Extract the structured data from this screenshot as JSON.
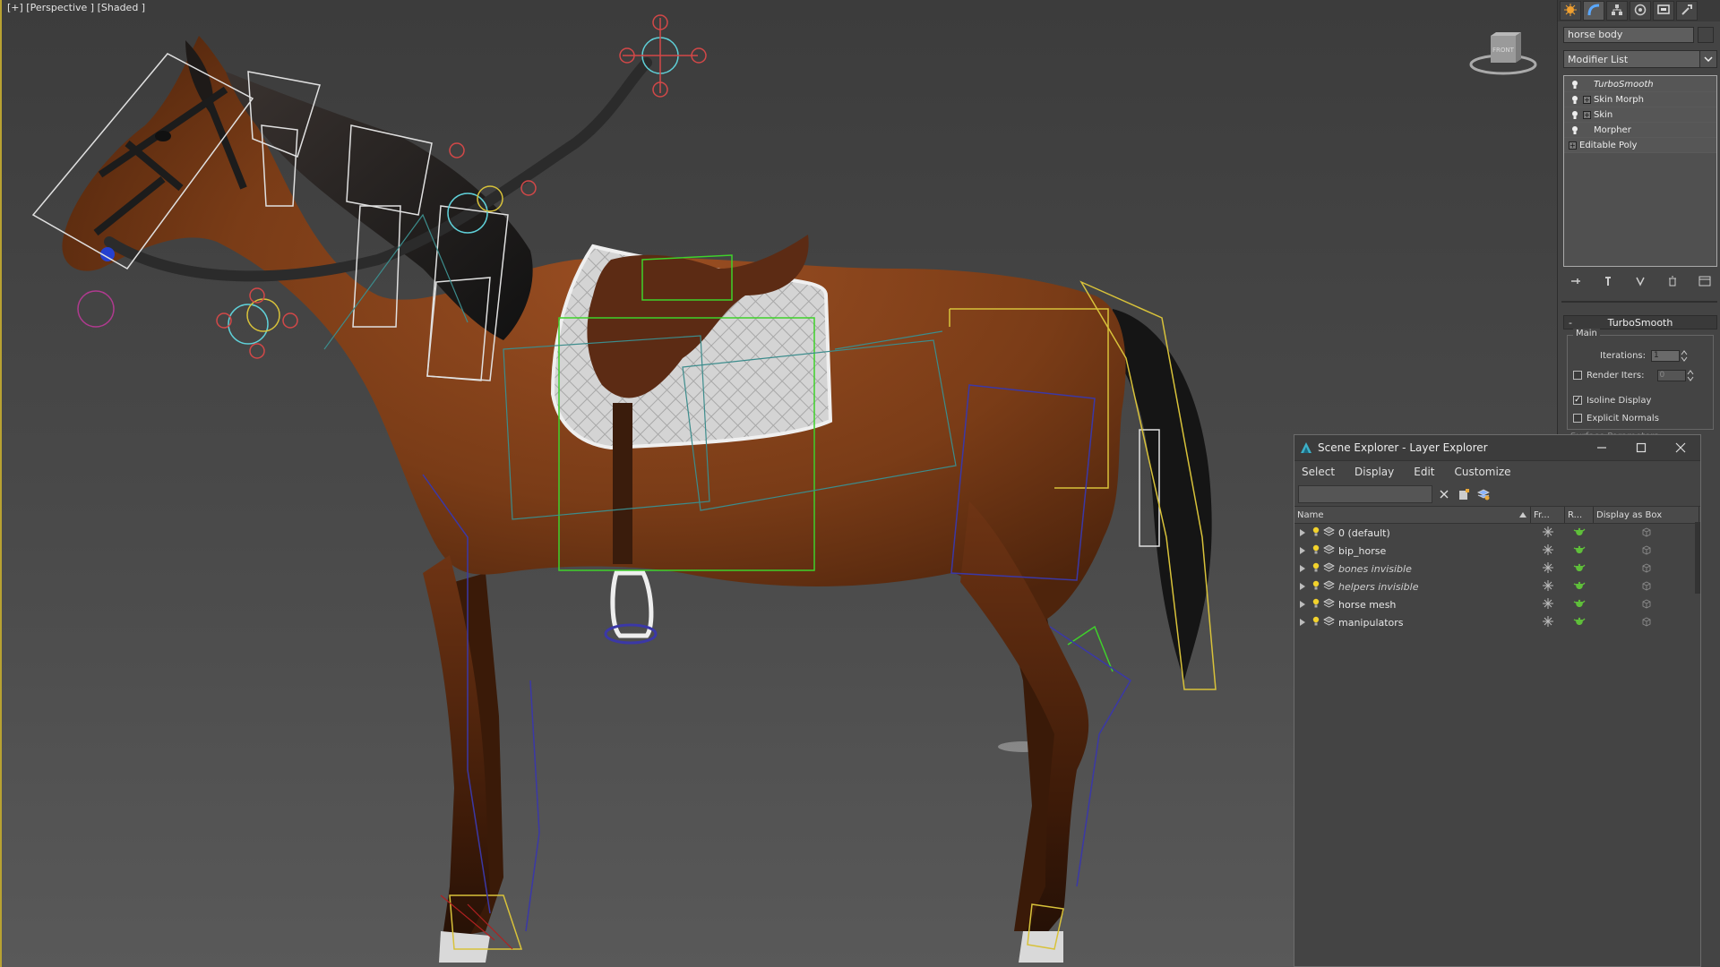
{
  "viewport": {
    "label": "[+] [Perspective ] [Shaded ]",
    "viewcube_label": "FRONT"
  },
  "command_panel": {
    "tabs": [
      "create-icon",
      "modify-icon",
      "hierarchy-icon",
      "motion-icon",
      "display-icon",
      "utilities-icon"
    ],
    "object_name": "horse body",
    "modifier_list_label": "Modifier List",
    "modifier_stack": [
      {
        "label": "TurboSmooth",
        "expandable": false
      },
      {
        "label": "Skin Morph",
        "expandable": true
      },
      {
        "label": "Skin",
        "expandable": true
      },
      {
        "label": "Morpher",
        "expandable": false
      },
      {
        "label": "Editable Poly",
        "expandable": true
      }
    ],
    "turbosmooth": {
      "rollout_title": "TurboSmooth",
      "collapse_symbol": "-",
      "group_label": "Main",
      "iterations_label": "Iterations:",
      "iterations_value": "1",
      "render_iters_label": "Render Iters:",
      "render_iters_value": "0",
      "isoline_label": "Isoline Display",
      "isoline_checked": true,
      "explicit_normals_label": "Explicit Normals",
      "explicit_normals_checked": false,
      "next_rollout_peek": "Surface Parameters"
    }
  },
  "scene_explorer": {
    "title": "Scene Explorer - Layer Explorer",
    "menu": [
      "Select",
      "Display",
      "Edit",
      "Customize"
    ],
    "columns": {
      "name": "Name",
      "freeze": "Fr...",
      "render": "R...",
      "display_box": "Display as Box"
    },
    "layers": [
      {
        "name": "0 (default)",
        "italic": false,
        "current": true
      },
      {
        "name": "bip_horse",
        "italic": false,
        "current": false
      },
      {
        "name": "bones invisible",
        "italic": true,
        "current": false
      },
      {
        "name": "helpers invisible",
        "italic": true,
        "current": false
      },
      {
        "name": "horse mesh",
        "italic": false,
        "current": false
      },
      {
        "name": "manipulators",
        "italic": false,
        "current": false
      }
    ]
  },
  "colors": {
    "viewport_border": "#b8a232",
    "horse_body": "#7a3c17",
    "wire_white": "#e0e0e0",
    "wire_green": "#3fd12b",
    "wire_blue": "#3b38a6",
    "wire_yellow": "#d8c23a",
    "wire_teal": "#3c8c8c"
  }
}
